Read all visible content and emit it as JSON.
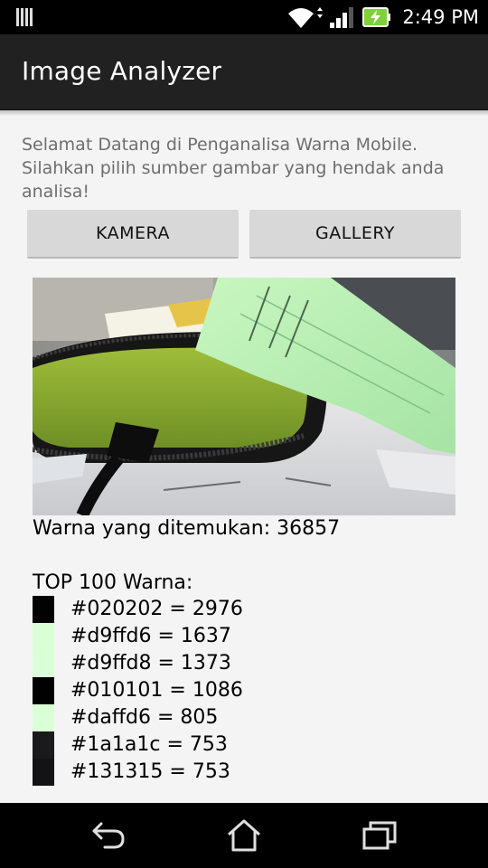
{
  "status_bar": {
    "time": "2:49 PM",
    "icons": [
      "notification-bars-icon",
      "wifi-icon",
      "signal-icon",
      "battery-charging-icon"
    ],
    "battery_color": "#7fd13b"
  },
  "app": {
    "title": "Image Analyzer"
  },
  "main": {
    "welcome_line1": "Selamat Datang di Penganalisa Warna Mobile.",
    "welcome_line2": "Silahkan pilih sumber gambar yang hendak anda analisa!",
    "kamera_label": "KAMERA",
    "gallery_label": "GALLERY",
    "found_label": "Warna yang ditemukan: 36857",
    "top_label": "TOP 100 Warna:",
    "colors": [
      {
        "hex": "#020202",
        "text": "#020202 = 2976"
      },
      {
        "hex": "#d9ffd6",
        "text": "#d9ffd6 = 1637"
      },
      {
        "hex": "#d9ffd8",
        "text": "#d9ffd8 = 1373"
      },
      {
        "hex": "#010101",
        "text": "#010101 = 1086"
      },
      {
        "hex": "#daffd6",
        "text": "#daffd6 = 805"
      },
      {
        "hex": "#1a1a1c",
        "text": "#1a1a1c = 753"
      },
      {
        "hex": "#131315",
        "text": "#131315 = 753"
      }
    ]
  },
  "nav_bar": {
    "icons": [
      "back-icon",
      "home-icon",
      "recent-apps-icon"
    ]
  }
}
